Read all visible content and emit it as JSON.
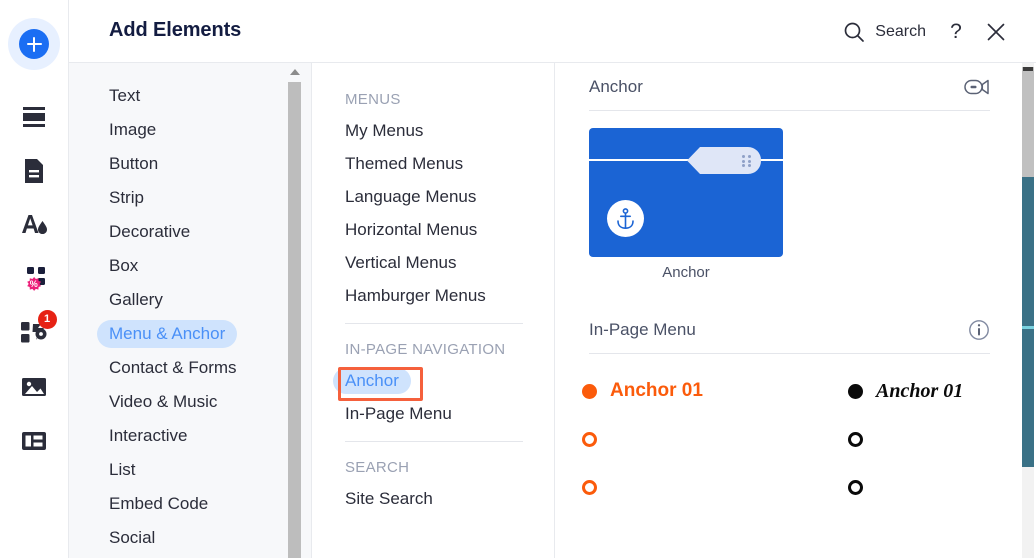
{
  "header": {
    "title": "Add Elements",
    "search_label": "Search",
    "search_icon": "search-icon",
    "help_label": "?",
    "close_icon": "close-icon"
  },
  "rail": {
    "add_button": {
      "icon": "plus-icon",
      "label": "Add"
    },
    "items": [
      {
        "icon": "strip-layout-icon",
        "label": "Strip"
      },
      {
        "icon": "page-document-icon",
        "label": "Pages"
      },
      {
        "icon": "theme-design-icon",
        "label": "Design"
      },
      {
        "icon": "apps-market-icon",
        "label": "App Market",
        "badge": null
      },
      {
        "icon": "add-apps-icon",
        "label": "My Apps",
        "badge": "1"
      },
      {
        "icon": "media-image-icon",
        "label": "Media"
      },
      {
        "icon": "database-table-icon",
        "label": "Content Manager"
      }
    ]
  },
  "categories": {
    "selected": "Menu & Anchor",
    "items": [
      {
        "label": "Text"
      },
      {
        "label": "Image"
      },
      {
        "label": "Button"
      },
      {
        "label": "Strip"
      },
      {
        "label": "Decorative"
      },
      {
        "label": "Box"
      },
      {
        "label": "Gallery"
      },
      {
        "label": "Menu & Anchor"
      },
      {
        "label": "Contact & Forms"
      },
      {
        "label": "Video & Music"
      },
      {
        "label": "Interactive"
      },
      {
        "label": "List"
      },
      {
        "label": "Embed Code"
      },
      {
        "label": "Social"
      }
    ]
  },
  "subcategories": {
    "selected": "Anchor",
    "groups": [
      {
        "title": "MENUS",
        "items": [
          {
            "label": "My Menus"
          },
          {
            "label": "Themed Menus"
          },
          {
            "label": "Language Menus"
          },
          {
            "label": "Horizontal Menus"
          },
          {
            "label": "Vertical Menus"
          },
          {
            "label": "Hamburger Menus"
          }
        ]
      },
      {
        "title": "IN-PAGE NAVIGATION",
        "items": [
          {
            "label": "Anchor"
          },
          {
            "label": "In-Page Menu"
          }
        ]
      },
      {
        "title": "SEARCH",
        "items": [
          {
            "label": "Site Search"
          }
        ]
      }
    ]
  },
  "preview": {
    "sections": [
      {
        "title": "Anchor",
        "icon": "video-camera-icon",
        "thumbnail": {
          "caption": "Anchor",
          "icon": "anchor-icon"
        }
      },
      {
        "title": "In-Page Menu",
        "icon": "info-icon",
        "samples": {
          "left": {
            "color": "#fb5b0b",
            "rows": [
              {
                "label": "Anchor 01",
                "dot": "filled"
              },
              {
                "label": "",
                "dot": "hollow"
              },
              {
                "label": "",
                "dot": "hollow"
              }
            ]
          },
          "right": {
            "color": "#0a0a0a",
            "rows": [
              {
                "label": "Anchor 01",
                "dot": "filled"
              },
              {
                "label": "",
                "dot": "hollow"
              },
              {
                "label": "",
                "dot": "hollow"
              }
            ]
          }
        }
      }
    ]
  },
  "colors": {
    "accent_blue": "#1b6ef3",
    "selected_pill": "#cfe3fd",
    "selected_text": "#4a90f7",
    "highlight_outline": "#f5603c",
    "thumb_blue": "#1b64d4",
    "orange": "#fb5b0b",
    "badge_red": "#e62214",
    "magenta": "#ec1e79"
  }
}
